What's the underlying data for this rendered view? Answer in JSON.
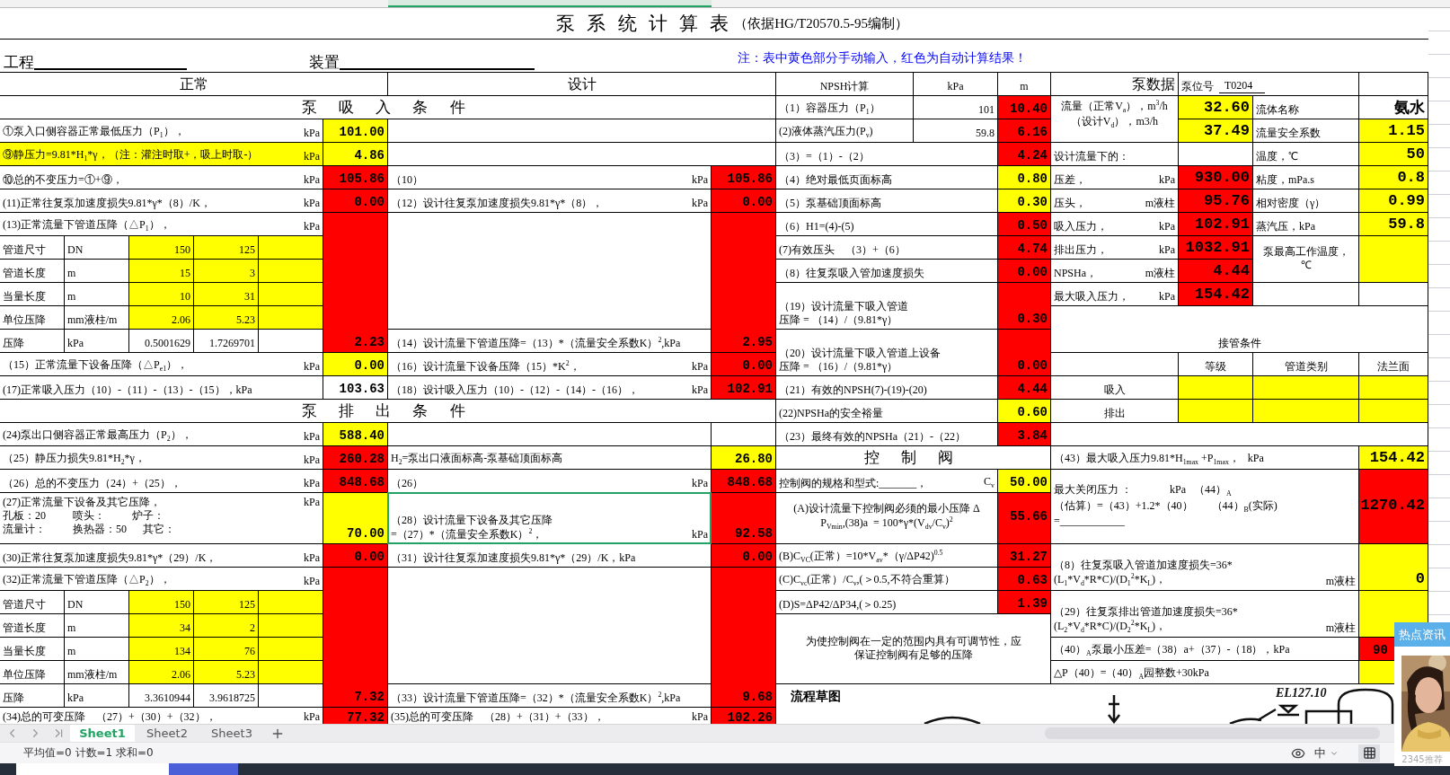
{
  "title": {
    "text": "泵 系 统 计 算 表",
    "note": "（依据HG/T20570.5-95编制）"
  },
  "info_line": {
    "project": "工程",
    "device": "装置",
    "note": "注：表中黄色部分手动输入，红色为自动计算结果！"
  },
  "cells": [
    {
      "text": "正常",
      "kind": "header"
    },
    {
      "text": "设计",
      "kind": "header"
    },
    {
      "text": "NPSH计算"
    },
    {
      "text": "kPa"
    },
    {
      "text": "m"
    },
    {
      "text": "泵数据",
      "kind": "header"
    },
    {
      "text": "泵位号",
      "field": "T0204"
    },
    {
      "text": "泵 吸 入 条 件",
      "kind": "section"
    },
    {
      "text": "（1）容器压力（P$_{1}$）"
    },
    {
      "text": "101"
    },
    {
      "text": "10.40",
      "color": "#ff0000",
      "kind": "value"
    },
    {
      "lines": [
        "流量（正常V$_{a}$），m$^{3}$/h",
        "（设计V$_{d}$），m3/h"
      ]
    },
    {
      "text": "32.60",
      "color": "#ffff00",
      "kind": "big-value"
    },
    {
      "text": "流体名称"
    },
    {
      "text": "氨水",
      "kind": "big"
    },
    {
      "text": "①泵入口侧容器正常最低压力（P$_{1}$），",
      "unit": "kPa"
    },
    {
      "text": "101.00",
      "color": "#ffff00",
      "kind": "value"
    },
    {
      "text": "(2)液体蒸汽压力(P$_{v}$)"
    },
    {
      "text": "59.8"
    },
    {
      "text": "6.16",
      "color": "#ff0000",
      "kind": "value"
    },
    {
      "text": "37.49",
      "color": "#ffff00",
      "kind": "big-value"
    },
    {
      "text": "流量安全系数"
    },
    {
      "text": "1.15",
      "color": "#ffff00",
      "kind": "big-value"
    },
    {
      "text": "⑨静压力=9.81*H$_{1}$*γ，（注：灌注时取+，吸上时取-）",
      "unit": "kPa",
      "color": "#ffff00"
    },
    {
      "text": "4.86",
      "color": "#ffff00",
      "kind": "value"
    },
    {
      "text": "（3）=（1）-（2）"
    },
    {
      "text": "4.24",
      "color": "#ff0000",
      "kind": "value"
    },
    {
      "text": "设计流量下的："
    },
    {
      "text": "温度，℃"
    },
    {
      "text": "50",
      "color": "#ffff00",
      "kind": "big-value"
    },
    {
      "text": "⑩总的不变压力=①+⑨，",
      "unit": "kPa"
    },
    {
      "text": "105.86",
      "color": "#ff0000",
      "kind": "value"
    },
    {
      "text": "（10）",
      "unit": "kPa"
    },
    {
      "text": "105.86",
      "color": "#ff0000",
      "kind": "value"
    },
    {
      "text": "（4）绝对最低页面标高"
    },
    {
      "text": "0.80",
      "color": "#ffff00",
      "kind": "value"
    },
    {
      "text": "压差，",
      "unit": "kPa"
    },
    {
      "text": "930.00",
      "color": "#ff0000",
      "kind": "big-value"
    },
    {
      "text": "粘度，mPa.s"
    },
    {
      "text": "0.8",
      "color": "#ffff00",
      "kind": "big-value"
    },
    {
      "text": "(11)正常往复泵加速度损失9.81*γ*（8）/K，",
      "unit": "kPa"
    },
    {
      "text": "0.00",
      "color": "#ff0000",
      "kind": "value"
    },
    {
      "text": "（12）设计往复泵加速度损失9.81*γ*（8），",
      "unit": "kPa"
    },
    {
      "text": "0.00",
      "color": "#ff0000",
      "kind": "value"
    },
    {
      "text": "（5）泵基础顶面标高"
    },
    {
      "text": "0.30",
      "color": "#ffff00",
      "kind": "value"
    },
    {
      "text": "压头，",
      "unit": "m液柱"
    },
    {
      "text": "95.76",
      "color": "#ff0000",
      "kind": "big-value"
    },
    {
      "text": "相对密度（γ）"
    },
    {
      "text": "0.99",
      "color": "#ffff00",
      "kind": "big-value"
    },
    {
      "text": "(13)正常流量下管道压降（△P$_{1}$），",
      "unit": "kPa"
    },
    {
      "text": "2.23",
      "color": "#ff0000",
      "kind": "value"
    },
    {
      "text": "2.95",
      "color": "#ff0000",
      "kind": "value"
    },
    {
      "text": "（6）H1=(4)-(5)"
    },
    {
      "text": "0.50",
      "color": "#ff0000",
      "kind": "value"
    },
    {
      "text": "吸入压力，",
      "unit": "kPa"
    },
    {
      "text": "102.91",
      "color": "#ff0000",
      "kind": "big-value"
    },
    {
      "text": "蒸汽压，kPa"
    },
    {
      "text": "59.8",
      "color": "#ffff00",
      "kind": "big-value"
    },
    {
      "text": "管道尺寸"
    },
    {
      "text": "DN"
    },
    {
      "text": "150",
      "color": "#ffff00"
    },
    {
      "text": "125",
      "color": "#ffff00"
    },
    {
      "color": "#ffff00"
    },
    {
      "text": "(7)有效压头　（3）+（6）"
    },
    {
      "text": "4.74",
      "color": "#ff0000",
      "kind": "value"
    },
    {
      "text": "排出压力，",
      "unit": "kPa"
    },
    {
      "text": "1032.91",
      "color": "#ff0000",
      "kind": "big-value"
    },
    {
      "lines": [
        "泵最高工作温度，",
        "℃"
      ]
    },
    {
      "color": "#ffff00"
    },
    {
      "text": "管道长度"
    },
    {
      "text": "m"
    },
    {
      "text": "15",
      "color": "#ffff00"
    },
    {
      "text": "3",
      "color": "#ffff00"
    },
    {
      "color": "#ffff00"
    },
    {
      "text": "（8）往复泵吸入管加速度损失"
    },
    {
      "text": "0.00",
      "color": "#ff0000",
      "kind": "value"
    },
    {
      "text": "NPSHa，",
      "unit": "m液柱"
    },
    {
      "text": "4.44",
      "color": "#ff0000",
      "kind": "big-value"
    },
    {
      "text": "当量长度"
    },
    {
      "text": "m"
    },
    {
      "text": "10",
      "color": "#ffff00"
    },
    {
      "text": "31",
      "color": "#ffff00"
    },
    {
      "color": "#ffff00"
    },
    {
      "lines": [
        "（19）设计流量下吸入管道",
        "压降 = （14）/（9.81*γ）"
      ]
    },
    {
      "text": "0.30",
      "color": "#ff0000",
      "kind": "value"
    },
    {
      "text": "最大吸入压力，",
      "unit": "kPa"
    },
    {
      "text": "154.42",
      "color": "#ff0000",
      "kind": "big-value"
    },
    {
      "text": "单位压降"
    },
    {
      "text": "mm液柱/m"
    },
    {
      "text": "2.06",
      "color": "#ffff00"
    },
    {
      "text": "5.23",
      "color": "#ffff00"
    },
    {
      "color": "#ffff00"
    },
    {
      "text": "压降"
    },
    {
      "text": "kPa"
    },
    {
      "text": "0.5001629"
    },
    {
      "text": "1.7269701"
    },
    {
      "text": "（14）设计流量下管道压降=（13）*（流量安全系数K）$^{2}$,kPa"
    },
    {
      "lines": [
        "（20）设计流量下吸入管道上设备",
        "压降 = （16）/（9.81*γ）"
      ]
    },
    {
      "text": "0.00",
      "color": "#ff0000",
      "kind": "value"
    },
    {
      "text": "接管条件"
    },
    {
      "text": "（15）正常流量下设备压降（△P$_{e1}$），",
      "unit": "kPa"
    },
    {
      "text": "0.00",
      "color": "#ffff00",
      "kind": "value"
    },
    {
      "text": "（16）设计流量下设备压降（15）*K$^{2}$，",
      "unit": "kPa"
    },
    {
      "text": "0.00",
      "color": "#ff0000",
      "kind": "value"
    },
    {
      "text": "等级"
    },
    {
      "text": "管道类别"
    },
    {
      "text": "法兰面"
    },
    {
      "text": "(17)正常吸入压力（10）-（11）-（13）-（15），kPa"
    },
    {
      "text": "103.63",
      "kind": "value"
    },
    {
      "text": "（18）设计吸入压力（10）-（12）-（14）-（16），",
      "unit": "kPa"
    },
    {
      "text": "102.91",
      "color": "#ff0000",
      "kind": "value"
    },
    {
      "text": "（21）有效的NPSH(7)-(19)-(20)"
    },
    {
      "text": "4.44",
      "color": "#ff0000",
      "kind": "value"
    },
    {
      "text": "吸入"
    },
    {
      "color": "#ffff00"
    },
    {
      "color": "#ffff00"
    },
    {
      "color": "#ffff00"
    },
    {
      "text": "泵 排 出 条 件",
      "kind": "section"
    },
    {
      "text": "(22)NPSHa的安全裕量"
    },
    {
      "text": "0.60",
      "color": "#ffff00",
      "kind": "value"
    },
    {
      "text": "排出"
    },
    {
      "color": "#ffff00"
    },
    {
      "color": "#ffff00"
    },
    {
      "color": "#ffff00"
    },
    {
      "text": "(24)泵出口侧容器正常最高压力（P$_{2}$），",
      "unit": "kPa"
    },
    {
      "text": "588.40",
      "color": "#ffff00",
      "kind": "value"
    },
    {
      "text": "（23）最终有效的NPSHa（21）-（22）"
    },
    {
      "text": "3.84",
      "color": "#ff0000",
      "kind": "value"
    },
    {
      "text": "（25）静压力损失9.81*H$_{2}$*γ，",
      "unit": "kPa"
    },
    {
      "text": "260.28",
      "color": "#ff0000",
      "kind": "value"
    },
    {
      "text": "H$_{2}$=泵出口液面标高-泵基础顶面标高"
    },
    {
      "text": "26.80",
      "color": "#ffff00",
      "kind": "value"
    },
    {
      "text": "控 制 阀",
      "kind": "section"
    },
    {
      "text": "（43）最大吸入压力9.81*H$_{1max}$ +P$_{1max}$，   kPa"
    },
    {
      "text": "154.42",
      "color": "#ffff00",
      "kind": "big-value"
    },
    {
      "text": "（26）总的不变压力（24）+（25），",
      "unit": "kPa"
    },
    {
      "text": "848.68",
      "color": "#ff0000",
      "kind": "value"
    },
    {
      "text": "（26）",
      "unit": "kPa"
    },
    {
      "text": "848.68",
      "color": "#ff0000",
      "kind": "value"
    },
    {
      "text": "控制阀的规格和型式:_______，",
      "unit": "C$_{v}$"
    },
    {
      "text": "50.00",
      "color": "#ffff00",
      "kind": "value"
    },
    {
      "lines": [
        "(27)正常流量下设备及其它压降，",
        "孔板：20          喷头：          炉子：",
        "流量计：          换热器：50      其它："
      ],
      "unit": "kPa"
    },
    {
      "text": "70.00",
      "color": "#ffff00",
      "kind": "value"
    },
    {
      "lines": [
        "（28）设计流量下设备及其它压降",
        "=（27）*（流量安全系数K）$^{2}$，"
      ],
      "unit": "kPa",
      "selected": true
    },
    {
      "text": "92.58",
      "color": "#ff0000",
      "kind": "value"
    },
    {
      "lines": [
        "(A)设计流量下控制阀必须的最小压降 Δ",
        "P$_{Vmin}$,(38)a  = 100*γ*(V$_{dv}$/C$_{v}$)$^{2}$"
      ]
    },
    {
      "text": "55.66",
      "color": "#ff0000",
      "kind": "value"
    },
    {
      "lines": [
        "最大关闭压力 ：              kPa   （44）$_{A}$",
        "（估算）=（43）+1.2*（40）       （44）$_{B}$(实际)",
        "=____________"
      ]
    },
    {
      "text": "1270.42",
      "color": "#ff0000",
      "kind": "big-value"
    },
    {
      "text": "(30)正常往复泵加速度损失9.81*γ*（29）/K，",
      "unit": "kPa"
    },
    {
      "text": "0.00",
      "color": "#ff0000",
      "kind": "value"
    },
    {
      "text": "（31）设计往复泵加速度损失9.81*γ*（29）/K，kPa"
    },
    {
      "text": "0.00",
      "color": "#ff0000",
      "kind": "value"
    },
    {
      "text": "(B)C$_{VC}$(正常）=10*V$_{av}$*（γ/ΔP42)$^{0.5}$"
    },
    {
      "text": "31.27",
      "color": "#ff0000",
      "kind": "value"
    },
    {
      "text": "(32)正常流量下管道压降（△P$_{2}$），",
      "unit": "kPa"
    },
    {
      "text": "7.32",
      "color": "#ff0000",
      "kind": "value"
    },
    {
      "text": "9.68",
      "color": "#ff0000",
      "kind": "value"
    },
    {
      "text": "(C)C$_{vc}$(正常）/C$_{v}$,(＞0.5,不符合重算）"
    },
    {
      "text": "0.63",
      "color": "#ff0000",
      "kind": "value"
    },
    {
      "lines": [
        "（8）往复泵吸入管道加速度损失=36*",
        "(L$_{1}$*V$_{d}$*R*C)/(D$_{1}$$^{2}$*K$_{L}$)，"
      ],
      "unit": "m液柱"
    },
    {
      "text": "0",
      "color": "#ffff00",
      "kind": "big-value"
    },
    {
      "text": "管道尺寸"
    },
    {
      "text": "DN"
    },
    {
      "text": "150",
      "color": "#ffff00"
    },
    {
      "text": "125",
      "color": "#ffff00"
    },
    {
      "color": "#ffff00"
    },
    {
      "text": "(D)S=ΔP42/ΔP34,(＞0.25)"
    },
    {
      "text": "1.39",
      "color": "#ff0000",
      "kind": "value"
    },
    {
      "text": "管道长度"
    },
    {
      "text": "m"
    },
    {
      "text": "34",
      "color": "#ffff00"
    },
    {
      "text": "2",
      "color": "#ffff00"
    },
    {
      "color": "#ffff00"
    },
    {
      "lines": [
        "（29）往复泵排出管道加速度损失=36*",
        "(L$_{2}$*V$_{d}$*R*C)/(D$_{2}$$^{2}$*K$_{L}$)，"
      ],
      "unit": "m液柱"
    },
    {
      "color": "#ffff00"
    },
    {
      "text": "当量长度"
    },
    {
      "text": "m"
    },
    {
      "text": "134",
      "color": "#ffff00"
    },
    {
      "text": "76",
      "color": "#ffff00"
    },
    {
      "color": "#ffff00"
    },
    {
      "lines": [
        "为使控制阀在一定的范围内具有可调节性，应",
        "保证控制阀有足够的压降"
      ]
    },
    {
      "text": "（40）$_{A}$泵最小压差=（38）a+（37）-（18），kPa"
    },
    {
      "text": "90",
      "color": "#ff0000",
      "kind": "value"
    },
    {
      "text": "单位压降"
    },
    {
      "text": "mm液柱/m"
    },
    {
      "text": "2.06",
      "color": "#ffff00"
    },
    {
      "text": "5.23",
      "color": "#ffff00"
    },
    {
      "color": "#ffff00"
    },
    {
      "text": "△P（40）=（40）$_{A}$园整数+30kPa"
    },
    {
      "color": "#ffff00"
    },
    {
      "text": "压降"
    },
    {
      "text": "kPa"
    },
    {
      "text": "3.3610944"
    },
    {
      "text": "3.9618725"
    },
    {
      "text": "（33）设计流量下管道压降=（32）*（流量安全系数K）$^{2}$,kPa"
    },
    {
      "text": "(34)总的可变压降　（27）+（30）+（32），",
      "unit": "kPa"
    },
    {
      "text": "77.32",
      "color": "#ff0000",
      "kind": "value"
    },
    {
      "text": "(35)总的可变压降　（28）+（31）+（33），",
      "unit": "kPa"
    },
    {
      "text": "102.26",
      "color": "#ff0000",
      "kind": "value"
    }
  ],
  "flow_sketch": {
    "title": "流程草图",
    "labels": [
      "EL127.10"
    ]
  },
  "sheet_tabs": [
    {
      "label": "Sheet1",
      "selected": true
    },
    {
      "label": "Sheet2",
      "selected": false
    },
    {
      "label": "Sheet3",
      "selected": false
    }
  ],
  "status_bar": {
    "summary": "平均值=0 计数=1 求和=0",
    "input_mode": "中"
  },
  "news_widget": {
    "title": "热点资讯",
    "source": "2345推荐"
  }
}
